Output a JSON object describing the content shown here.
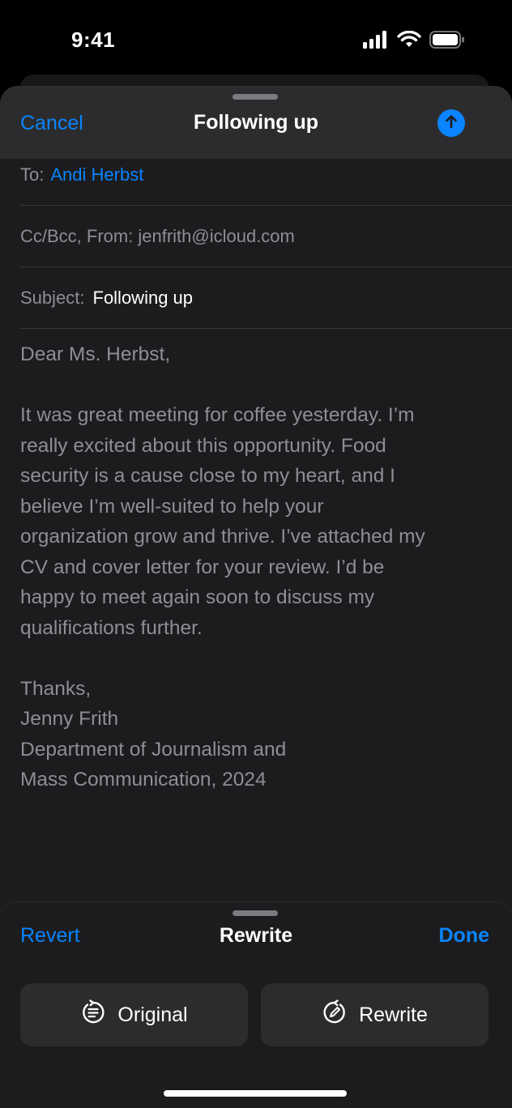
{
  "status_bar": {
    "time": "9:41",
    "icons": [
      "cellular-signal-icon",
      "wifi-icon",
      "battery-icon"
    ]
  },
  "compose": {
    "cancel_label": "Cancel",
    "title": "Following up",
    "send_icon": "arrow-up-icon",
    "to_label": "To:",
    "to_value": "Andi Herbst",
    "cc_from_label": "Cc/Bcc, From:",
    "cc_from_value": "jenfrith@icloud.com",
    "subject_label": "Subject:",
    "subject_value": "Following up",
    "body": {
      "greeting": "Dear Ms. Herbst,",
      "paragraph_lines": [
        "It was great meeting for coffee yesterday. I’m",
        "really excited about this opportunity. Food",
        "security is a cause close to my heart, and I",
        "believe I’m well-suited to help your",
        "organization grow and thrive. I’ve attached my",
        "CV and cover letter for your review. I’d be",
        "happy to meet again soon to discuss my",
        "qualifications further."
      ],
      "signoff_lines": [
        "Thanks,",
        "Jenny Frith",
        "Department of Journalism and",
        "Mass Communication, 2024"
      ]
    }
  },
  "rewrite_panel": {
    "revert_label": "Revert",
    "title": "Rewrite",
    "done_label": "Done",
    "options": [
      {
        "label": "Original",
        "icon": "original-text-icon"
      },
      {
        "label": "Rewrite",
        "icon": "rewrite-icon"
      }
    ]
  },
  "colors": {
    "accent": "#0a84ff",
    "background": "#1c1c1e",
    "header": "#2c2c2e",
    "body_text": "#8e8e93"
  }
}
